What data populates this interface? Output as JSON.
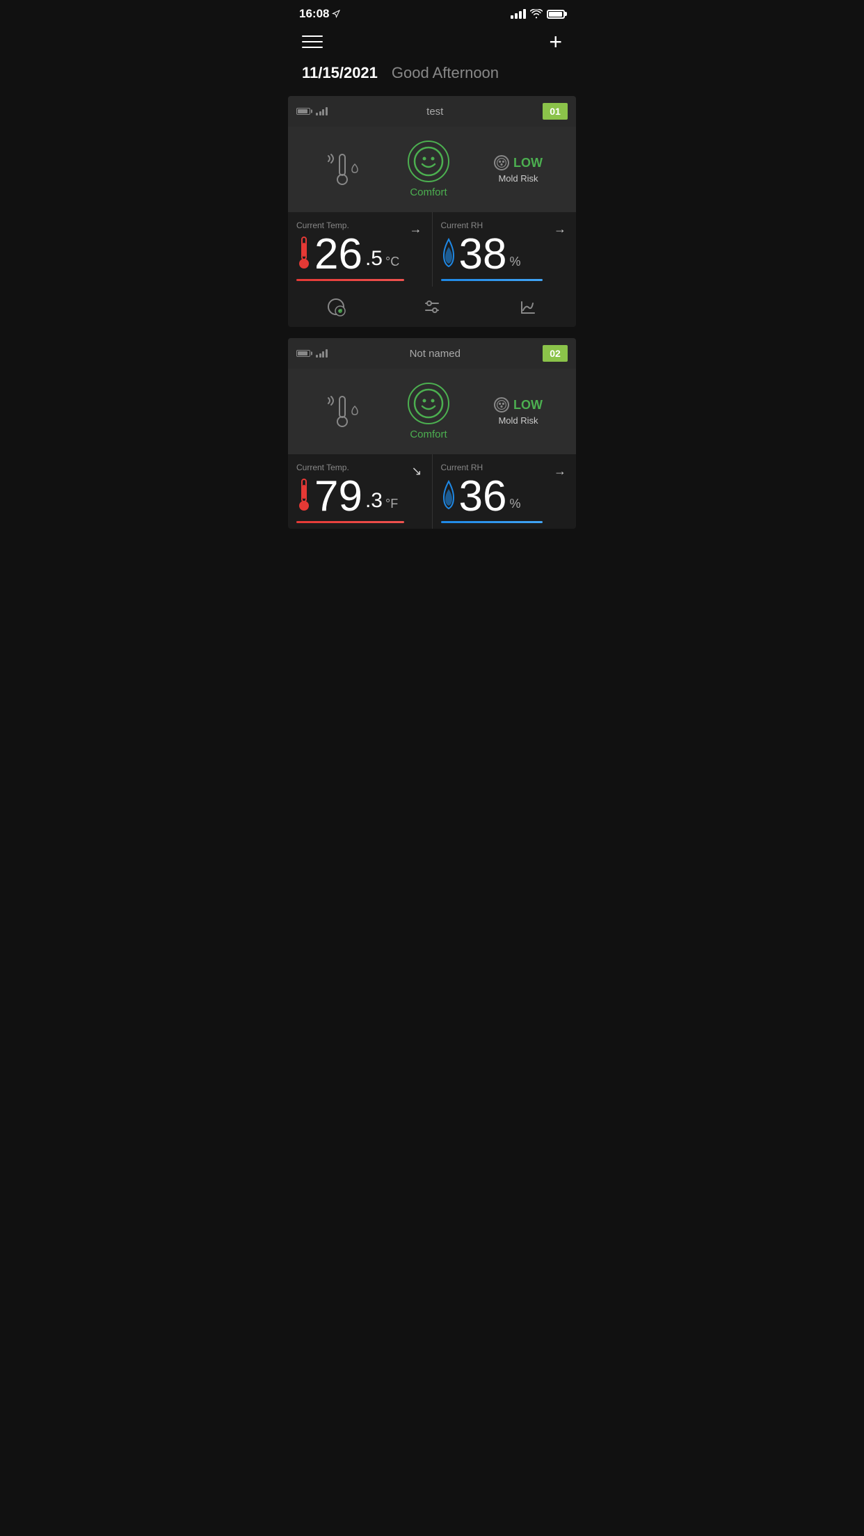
{
  "statusBar": {
    "time": "16:08",
    "locationIcon": "▷"
  },
  "topNav": {
    "addButton": "+"
  },
  "header": {
    "date": "11/15/2021",
    "greeting": "Good Afternoon"
  },
  "devices": [
    {
      "name": "test",
      "number": "01",
      "comfort": "Comfort",
      "moldRiskLevel": "LOW",
      "moldRiskLabel": "Mold Risk",
      "currentTempLabel": "Current Temp.",
      "currentRhLabel": "Current RH",
      "tempValue": "26",
      "tempDecimal": ".5",
      "tempUnit": "°C",
      "tempArrow": "→",
      "rhValue": "38",
      "rhUnit": "%",
      "rhArrow": "→"
    },
    {
      "name": "Not named",
      "number": "02",
      "comfort": "Comfort",
      "moldRiskLevel": "LOW",
      "moldRiskLabel": "Mold Risk",
      "currentTempLabel": "Current Temp.",
      "currentRhLabel": "Current RH",
      "tempValue": "79",
      "tempDecimal": ".3",
      "tempUnit": "°F",
      "tempArrow": "↘",
      "rhValue": "36",
      "rhUnit": "%",
      "rhArrow": "→"
    }
  ],
  "bottomIcons": {
    "alertLabel": "alert-icon",
    "settingsLabel": "settings-icon",
    "chartLabel": "chart-icon"
  }
}
